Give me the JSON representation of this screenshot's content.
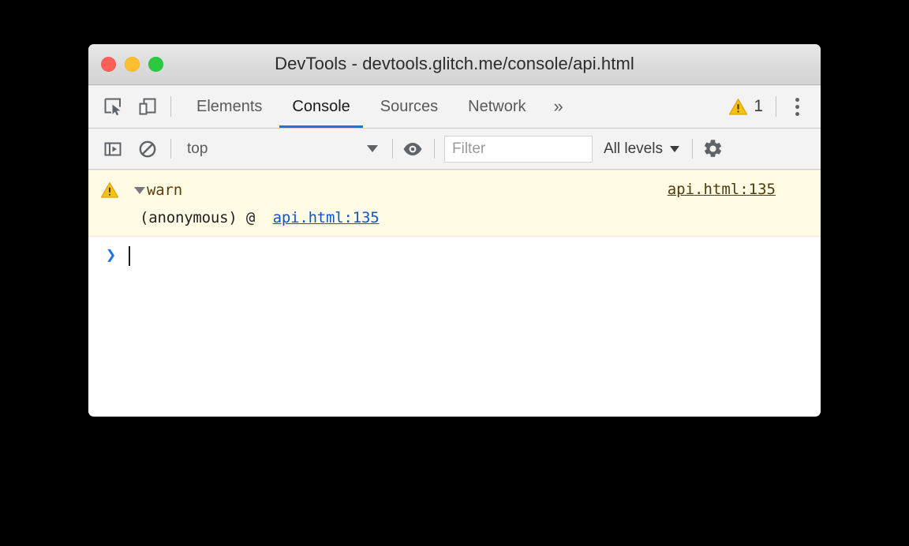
{
  "window": {
    "title": "DevTools - devtools.glitch.me/console/api.html",
    "traffic_lights": [
      {
        "name": "close",
        "color": "#ff6159"
      },
      {
        "name": "minimize",
        "color": "#ffbe2f"
      },
      {
        "name": "maximize",
        "color": "#2ac940"
      }
    ]
  },
  "tabstrip": {
    "inspect_icon": "inspect-element-icon",
    "device_icon": "device-toolbar-icon",
    "tabs": [
      {
        "label": "Elements",
        "active": false
      },
      {
        "label": "Console",
        "active": true
      },
      {
        "label": "Sources",
        "active": false
      },
      {
        "label": "Network",
        "active": false
      }
    ],
    "overflow_label": "»",
    "warning_count": "1",
    "warning_icon": "warning-triangle-icon",
    "menu_icon": "kebab-menu-icon"
  },
  "console_toolbar": {
    "sidebar_icon": "console-sidebar-icon",
    "clear_icon": "clear-console-icon",
    "context": "top",
    "eye_icon": "live-expression-eye-icon",
    "filter_placeholder": "Filter",
    "filter_value": "",
    "levels_label": "All levels",
    "settings_icon": "settings-gear-icon"
  },
  "console": {
    "messages": [
      {
        "type": "warning",
        "icon": "warning-triangle-icon",
        "expanded": true,
        "text": "warn",
        "source_link": "api.html:135",
        "stack": [
          {
            "frame": "(anonymous) @",
            "link": "api.html:135"
          }
        ]
      }
    ],
    "prompt": {
      "chevron": "›",
      "input_value": ""
    }
  },
  "colors": {
    "accent": "#1a73e8",
    "warning_bg": "#fffbe5",
    "warning_icon": "#f5a623",
    "link": "#1155cc",
    "warn_text": "#5c3c0a"
  }
}
